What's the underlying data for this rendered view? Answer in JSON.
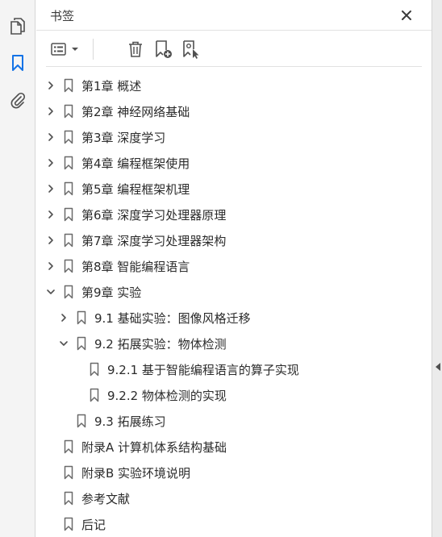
{
  "panel": {
    "title": "书签"
  },
  "tree": [
    {
      "label": "第1章 概述",
      "level": 0,
      "state": "collapsed"
    },
    {
      "label": "第2章 神经网络基础",
      "level": 0,
      "state": "collapsed"
    },
    {
      "label": "第3章 深度学习",
      "level": 0,
      "state": "collapsed"
    },
    {
      "label": "第4章 编程框架使用",
      "level": 0,
      "state": "collapsed"
    },
    {
      "label": "第5章 编程框架机理",
      "level": 0,
      "state": "collapsed"
    },
    {
      "label": "第6章 深度学习处理器原理",
      "level": 0,
      "state": "collapsed"
    },
    {
      "label": "第7章 深度学习处理器架构",
      "level": 0,
      "state": "collapsed"
    },
    {
      "label": "第8章 智能编程语言",
      "level": 0,
      "state": "collapsed"
    },
    {
      "label": "第9章 实验",
      "level": 0,
      "state": "expanded"
    },
    {
      "label": "9.1 基础实验：图像风格迁移",
      "level": 1,
      "state": "collapsed"
    },
    {
      "label": "9.2 拓展实验：物体检测",
      "level": 1,
      "state": "expanded"
    },
    {
      "label": "9.2.1 基于智能编程语言的算子实现",
      "level": 2,
      "state": "leaf"
    },
    {
      "label": "9.2.2 物体检测的实现",
      "level": 2,
      "state": "leaf"
    },
    {
      "label": "9.3 拓展练习",
      "level": 1,
      "state": "leaf"
    },
    {
      "label": "附录A 计算机体系结构基础",
      "level": 0,
      "state": "leaf"
    },
    {
      "label": "附录B 实验环境说明",
      "level": 0,
      "state": "leaf"
    },
    {
      "label": "参考文献",
      "level": 0,
      "state": "leaf"
    },
    {
      "label": "后记",
      "level": 0,
      "state": "leaf"
    }
  ],
  "colors": {
    "accent": "#1473e6",
    "icon": "#505050",
    "text": "#2b2b2b"
  }
}
